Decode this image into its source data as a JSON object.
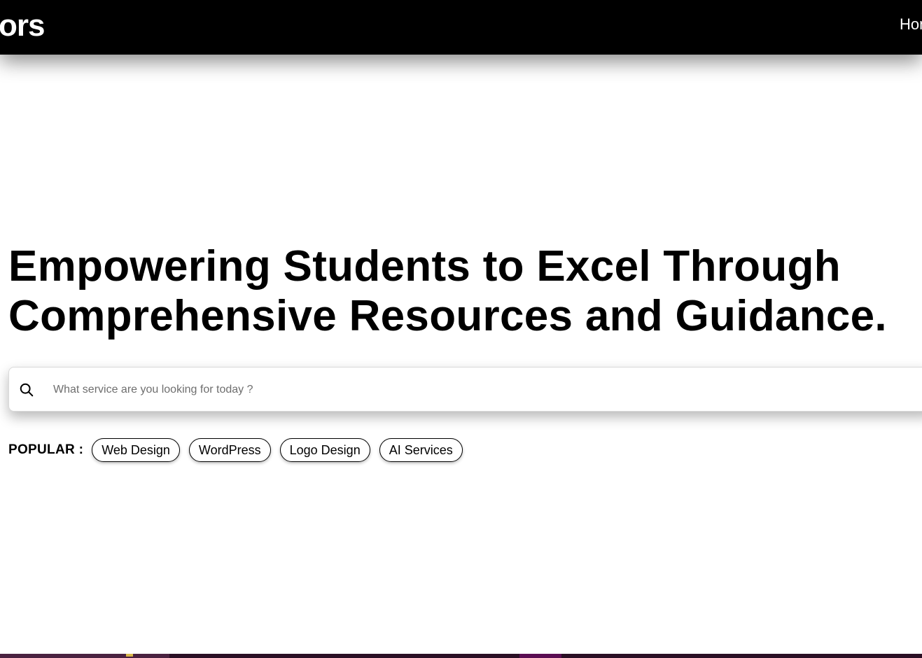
{
  "navbar": {
    "brand": "ors",
    "link_home": "Home"
  },
  "hero": {
    "title_line1": "Empowering Students to Excel Through",
    "title_line2": "Comprehensive Resources and Guidance."
  },
  "search": {
    "placeholder": "What service are you looking for today ?",
    "value": "",
    "icon": "search-icon"
  },
  "popular": {
    "label": "POPULAR :",
    "tags": [
      "Web Design",
      "WordPress",
      "Logo Design",
      "AI Services"
    ]
  },
  "colors": {
    "navbar_bg": "#000000",
    "text": "#000000",
    "background": "#ffffff"
  }
}
